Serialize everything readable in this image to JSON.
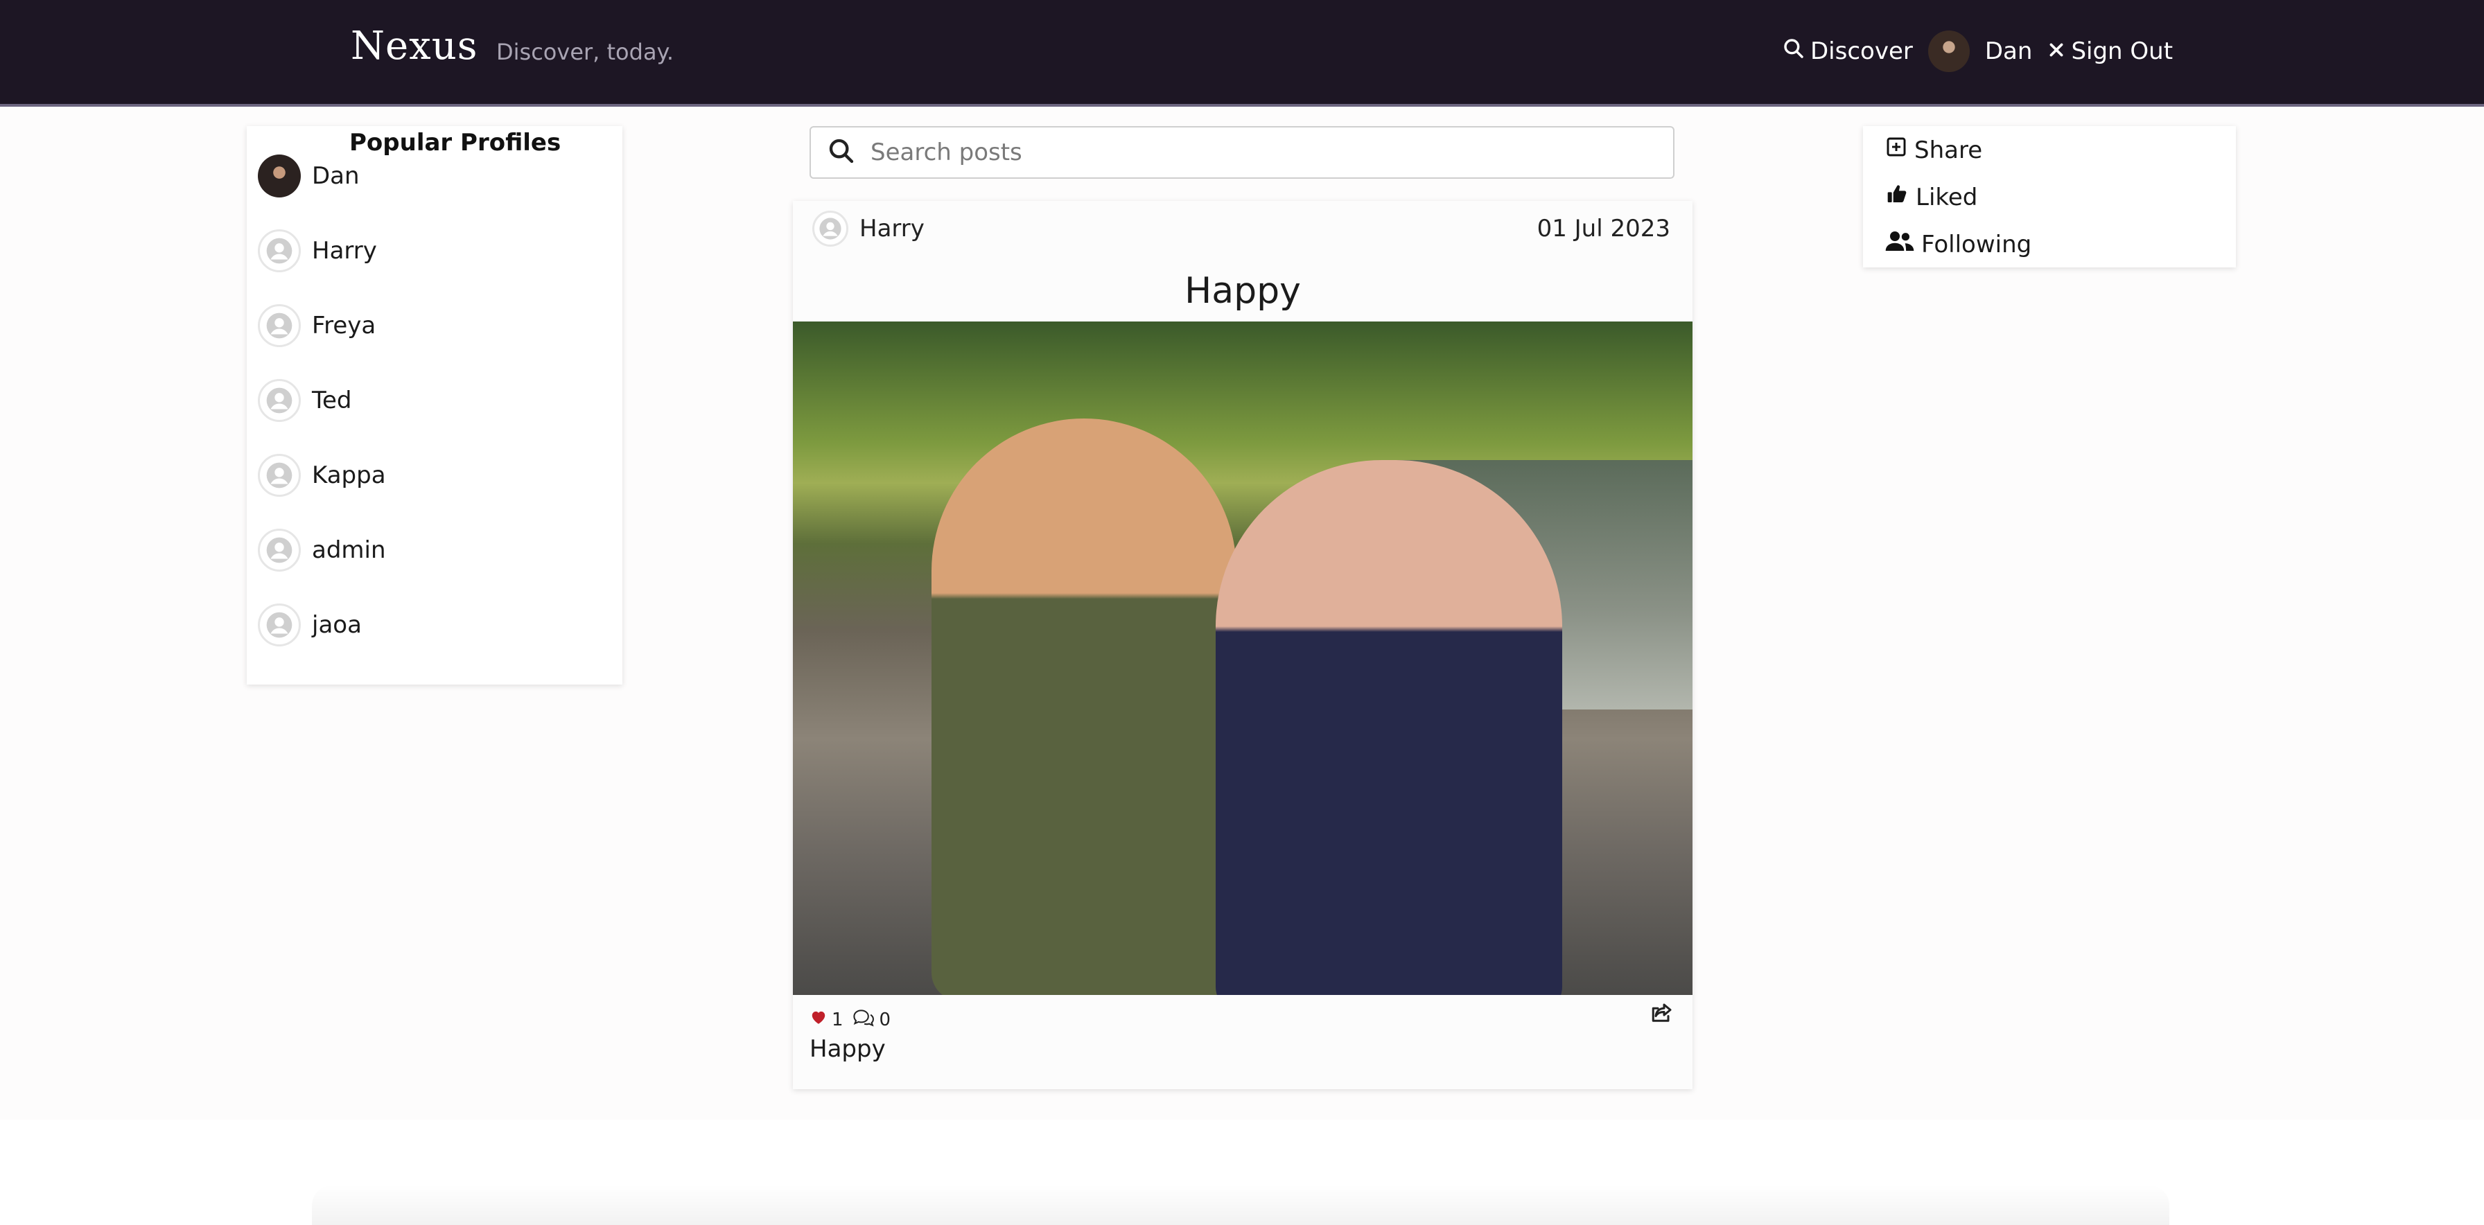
{
  "navbar": {
    "brand": "Nexus",
    "tagline": "Discover, today.",
    "discover_label": "Discover",
    "user_name": "Dan",
    "signout_label": "Sign Out"
  },
  "profiles": {
    "title": "Popular Profiles",
    "items": [
      {
        "name": "Dan",
        "has_photo": true
      },
      {
        "name": "Harry",
        "has_photo": false
      },
      {
        "name": "Freya",
        "has_photo": false
      },
      {
        "name": "Ted",
        "has_photo": false
      },
      {
        "name": "Kappa",
        "has_photo": false
      },
      {
        "name": "admin",
        "has_photo": false
      },
      {
        "name": "jaoa",
        "has_photo": false
      }
    ]
  },
  "search": {
    "placeholder": "Search posts",
    "value": ""
  },
  "post": {
    "author": "Harry",
    "date": "01 Jul 2023",
    "title": "Happy",
    "likes": "1",
    "comments": "0",
    "caption": "Happy"
  },
  "menu": {
    "items": [
      {
        "label": "Share",
        "icon": "plus-square-icon"
      },
      {
        "label": "Liked",
        "icon": "thumbs-up-icon"
      },
      {
        "label": "Following",
        "icon": "users-icon"
      }
    ]
  },
  "colors": {
    "navbar_bg": "#1d1624",
    "like_red": "#c0202a",
    "page_bg": "#fdfcfc"
  }
}
